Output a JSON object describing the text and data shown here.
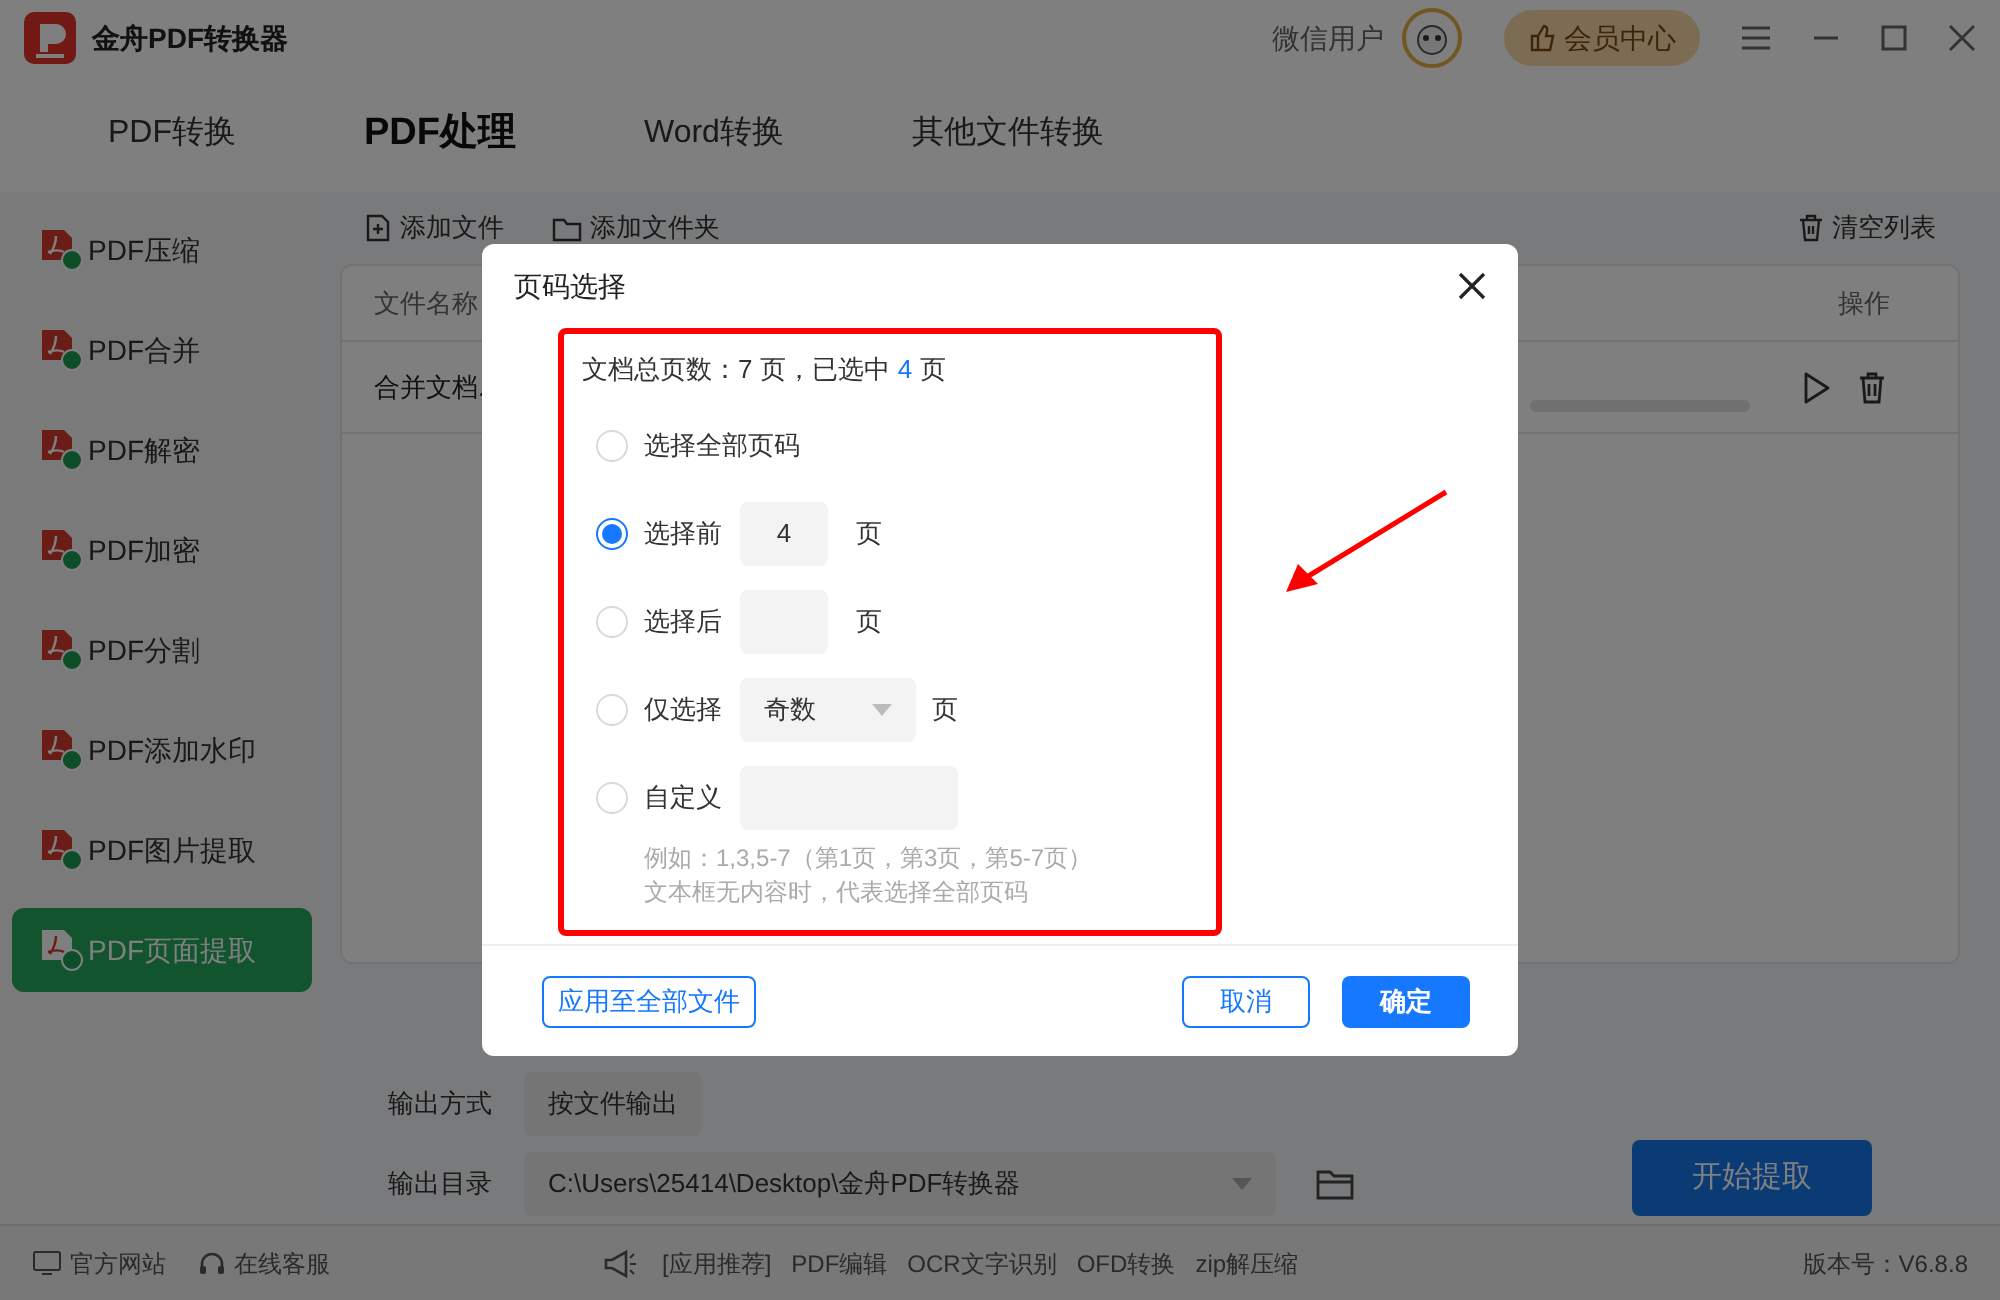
{
  "window": {
    "title": "金舟PDF转换器",
    "user": "微信用户",
    "vip_button": "会员中心"
  },
  "tabs": [
    {
      "label": "PDF转换",
      "selected": false
    },
    {
      "label": "PDF处理",
      "selected": true
    },
    {
      "label": "Word转换",
      "selected": false
    },
    {
      "label": "其他文件转换",
      "selected": false
    }
  ],
  "sidebar": {
    "items": [
      {
        "label": "PDF压缩",
        "selected": false
      },
      {
        "label": "PDF合并",
        "selected": false
      },
      {
        "label": "PDF解密",
        "selected": false
      },
      {
        "label": "PDF加密",
        "selected": false
      },
      {
        "label": "PDF分割",
        "selected": false
      },
      {
        "label": "PDF添加水印",
        "selected": false
      },
      {
        "label": "PDF图片提取",
        "selected": false
      },
      {
        "label": "PDF页面提取",
        "selected": true
      }
    ]
  },
  "toolbar": {
    "add_file": "添加文件",
    "add_folder": "添加文件夹",
    "clear_list": "清空列表"
  },
  "table": {
    "columns": [
      "文件名称",
      "操作"
    ],
    "rows": [
      {
        "name": "合并文档.",
        "level": 0
      }
    ]
  },
  "output": {
    "mode_label": "输出方式",
    "mode_value": "按文件输出",
    "dir_label": "输出目录",
    "dir_value": "C:\\Users\\25414\\Desktop\\金舟PDF转换器",
    "start_button": "开始提取"
  },
  "status_bar": {
    "links": [
      "官方网站",
      "在线客服"
    ],
    "recommend": [
      "[应用推荐]",
      "PDF编辑",
      "OCR文字识别",
      "OFD转换",
      "zip解压缩"
    ],
    "version": "版本号：V6.8.8"
  },
  "dialog": {
    "title": "页码选择",
    "summary_prefix": "文档总页数：7 页，已选中",
    "selected_count": "4",
    "summary_suffix": "页",
    "options": [
      {
        "kind": "plain",
        "label": "选择全部页码",
        "selected": false
      },
      {
        "kind": "number",
        "label": "选择前",
        "value": "4",
        "unit": "页",
        "selected": true
      },
      {
        "kind": "number",
        "label": "选择后",
        "unit": "页",
        "selected": false
      },
      {
        "kind": "select",
        "label": "仅选择",
        "value": "奇数",
        "unit": "页",
        "selected": false
      },
      {
        "kind": "text",
        "label": "自定义",
        "selected": false
      }
    ],
    "hint": [
      "例如：1,3,5-7（第1页，第3页，第5-7页）",
      "文本框无内容时，代表选择全部页码"
    ],
    "apply_all_button": "应用至全部文件",
    "cancel_button": "取消",
    "ok_button": "确定"
  }
}
